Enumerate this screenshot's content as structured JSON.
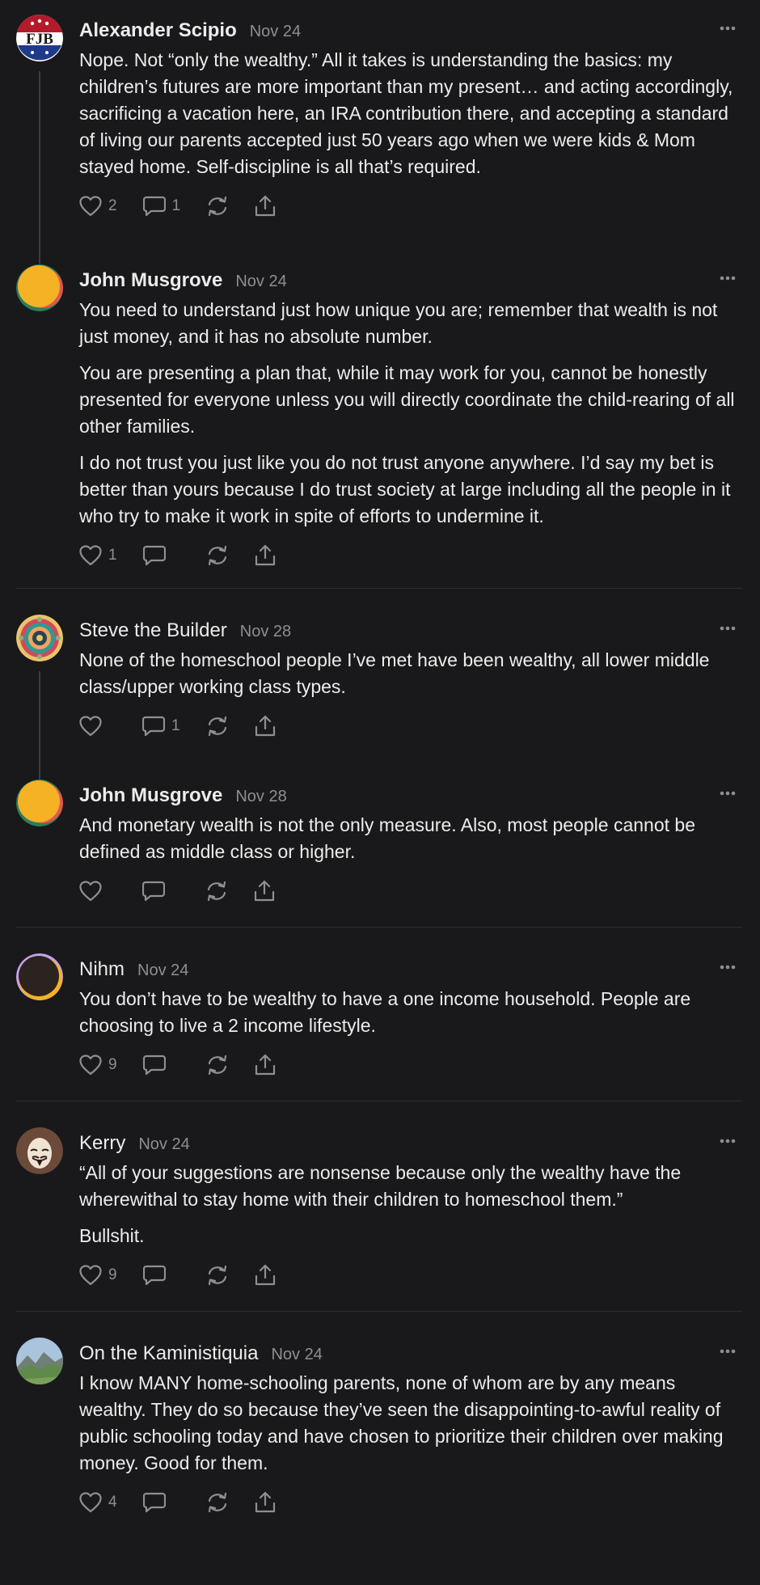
{
  "comments": [
    {
      "author": "Alexander Scipio",
      "date": "Nov 24",
      "avatar": "fjb-badge-avatar",
      "avatar_text": "FJB",
      "paragraphs": [
        "Nope. Not “only the wealthy.” All it takes is understanding the basics: my children’s futures are more important than my present… and acting accordingly, sacrificing a vacation here, an IRA contribution there, and accepting a standard of living our parents accepted just 50 years ago when we were kids & Mom stayed home. Self-discipline is all that’s required."
      ],
      "likes": "2",
      "replies": "1"
    },
    {
      "author": "John Musgrove",
      "date": "Nov 24",
      "avatar": "orange-circle-avatar",
      "paragraphs": [
        "You need to understand just how unique you are; remember that wealth is not just money, and it has no absolute number.",
        "You are presenting a plan that, while it may work for you, cannot be honestly presented for everyone unless you will directly coordinate the child-rearing of all other families.",
        "I do not trust you just like you do not trust anyone anywhere. I’d say my bet is better than yours because I do trust society at large including all the people in it who try to make it work in spite of efforts to undermine it."
      ],
      "likes": "1",
      "replies": ""
    },
    {
      "author": "Steve the Builder",
      "date": "Nov 28",
      "avatar": "mandala-avatar",
      "paragraphs": [
        "None of the homeschool people I’ve met have been wealthy, all lower middle class/upper working class types."
      ],
      "likes": "",
      "replies": "1"
    },
    {
      "author": "John Musgrove",
      "date": "Nov 28",
      "avatar": "orange-circle-avatar",
      "paragraphs": [
        "And monetary wealth is not the only measure. Also, most people cannot be defined as middle class or higher."
      ],
      "likes": "",
      "replies": ""
    },
    {
      "author": "Nihm",
      "date": "Nov 24",
      "avatar": "dark-circle-avatar",
      "paragraphs": [
        "You don’t have to be wealthy to have a one income household. People are choosing to live a 2 income lifestyle."
      ],
      "likes": "9",
      "replies": ""
    },
    {
      "author": "Kerry",
      "date": "Nov 24",
      "avatar": "mask-avatar",
      "paragraphs": [
        "“All of your suggestions are nonsense because only the wealthy have the wherewithal to stay home with their children to homeschool them.”",
        "Bullshit."
      ],
      "likes": "9",
      "replies": ""
    },
    {
      "author": "On the Kaministiquia",
      "date": "Nov 24",
      "avatar": "landscape-avatar",
      "paragraphs": [
        "I know MANY home-schooling parents, none of whom are by any means wealthy. They do so because they’ve seen the disappointing-to-awful reality of public schooling today and have chosen to prioritize their children over making money. Good for them."
      ],
      "likes": "4",
      "replies": ""
    }
  ],
  "icons": {
    "like": "heart-icon",
    "reply": "comment-icon",
    "restack": "restack-icon",
    "share": "share-icon",
    "more": "more-icon"
  },
  "colors": {
    "background": "#19191b",
    "text": "#ececec",
    "muted": "#8e8e93"
  }
}
